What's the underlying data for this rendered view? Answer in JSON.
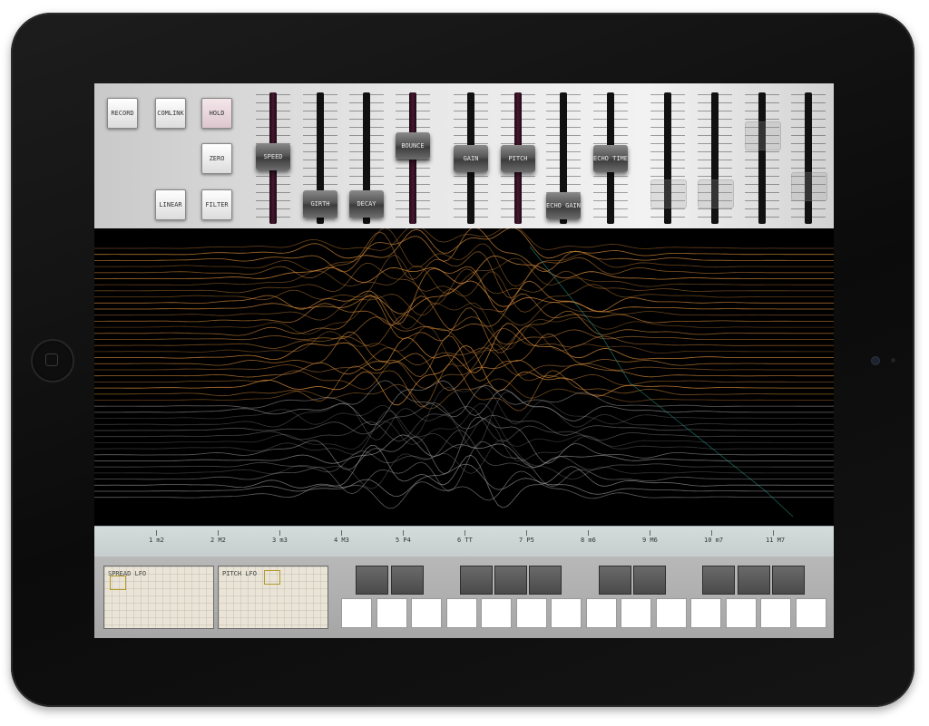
{
  "panel": {
    "buttons": {
      "record": "RECORD",
      "comlink": "COMLINK",
      "hold": "HOLD",
      "zero": "ZERO",
      "linear": "LINEAR",
      "filter": "FILTER"
    },
    "sliders": {
      "speed": "SPEED",
      "girth": "GIRTH",
      "decay": "DECAY",
      "bounce": "BOUNCE",
      "gain": "GAIN",
      "pitch": "PITCH",
      "echo_gain": "ECHO GAIN",
      "echo_time": "ECHO TIME"
    }
  },
  "ruler": {
    "intervals": [
      "1 m2",
      "2 M2",
      "3 m3",
      "4 M3",
      "5 P4",
      "6 TT",
      "7 P5",
      "8 m6",
      "9 M6",
      "10 m7",
      "11 M7"
    ]
  },
  "lfo": {
    "spread": "SPREAD LFO",
    "pitch": "PITCH LFO"
  },
  "colors": {
    "wave_warm": "#d58a3a",
    "wave_cool": "#bcbcbc",
    "wave_teal": "#2aa89a"
  }
}
